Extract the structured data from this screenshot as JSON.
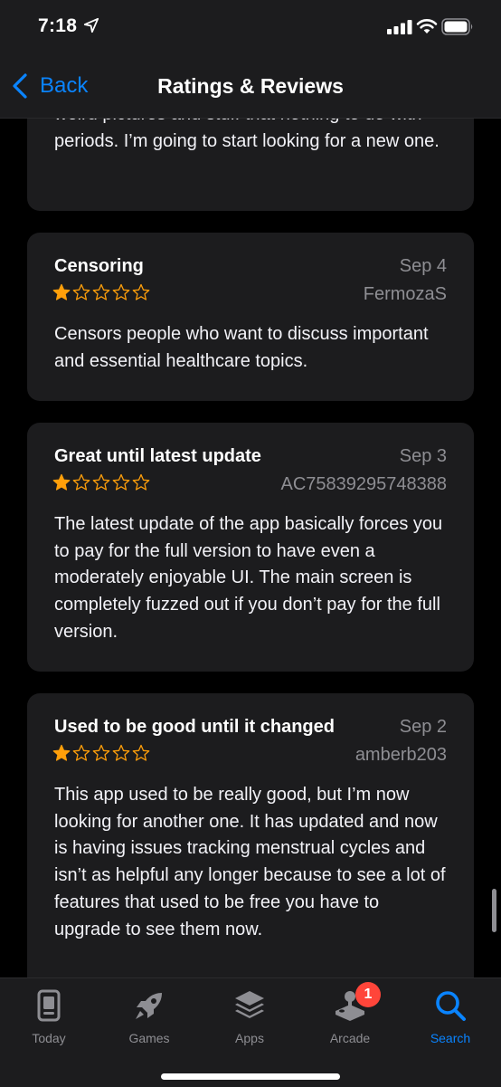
{
  "status": {
    "time": "7:18"
  },
  "nav": {
    "back_label": "Back",
    "title": "Ratings & Reviews"
  },
  "partial_review": {
    "body": "weird pictures and stuff that nothing to do with periods. I’m going to start looking for a new one."
  },
  "reviews": [
    {
      "title": "Censoring",
      "date": "Sep 4",
      "rating": 1,
      "author": "FermozaS",
      "body": "Censors people who want to discuss important and essential healthcare topics."
    },
    {
      "title": "Great until latest update",
      "date": "Sep 3",
      "rating": 1,
      "author": "AC75839295748388",
      "body": "The latest update of the app basically forces you to pay for the full version to have even a moderately enjoyable UI. The main screen is completely fuzzed out if you don’t pay for the full version."
    },
    {
      "title": "Used to be good until it changed",
      "date": "Sep 2",
      "rating": 1,
      "author": "amberb203",
      "body": "This app used to be really good, but I’m now looking for another one. It has updated and now is having issues tracking menstrual cycles and isn’t as helpful any longer because to see a lot of features that used to be free you have to upgrade to see them now."
    }
  ],
  "tabbar": {
    "items": [
      {
        "label": "Today",
        "icon": "today-icon"
      },
      {
        "label": "Games",
        "icon": "rocket-icon"
      },
      {
        "label": "Apps",
        "icon": "apps-stack-icon"
      },
      {
        "label": "Arcade",
        "icon": "joystick-icon",
        "badge": "1"
      },
      {
        "label": "Search",
        "icon": "search-icon",
        "active": true
      }
    ]
  },
  "colors": {
    "accent": "#0a84ff",
    "star": "#ff9f0a",
    "badge": "#ff453a",
    "card": "#1c1c1e",
    "secondary_text": "#8e8e93"
  }
}
